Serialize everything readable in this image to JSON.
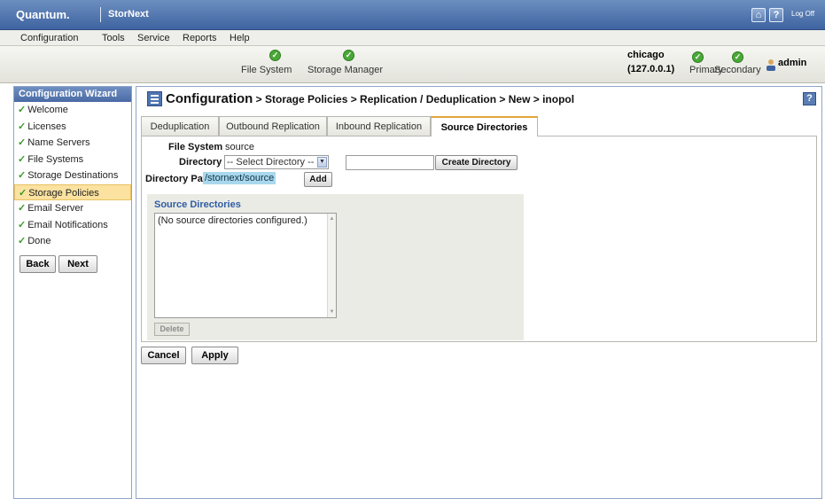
{
  "header": {
    "brand": "Quantum.",
    "product": "StorNext",
    "logoff": "Log Off"
  },
  "menu": [
    "Configuration",
    "Tools",
    "Service",
    "Reports",
    "Help"
  ],
  "status": {
    "file_system": "File System",
    "storage_manager": "Storage Manager",
    "host": "chicago",
    "ip": "(127.0.0.1)",
    "primary": "Primary",
    "secondary": "Secondary",
    "user": "admin",
    "ok_color": "#4aa838"
  },
  "wizard": {
    "title": "Configuration Wizard",
    "items": [
      {
        "label": "Welcome"
      },
      {
        "label": "Licenses"
      },
      {
        "label": "Name Servers"
      },
      {
        "label": "File Systems"
      },
      {
        "label": "Storage Destinations"
      },
      {
        "label": "Storage Policies",
        "active": true
      },
      {
        "label": "Email Server"
      },
      {
        "label": "Email Notifications"
      },
      {
        "label": "Done"
      }
    ],
    "back": "Back",
    "next": "Next"
  },
  "main": {
    "title": "Configuration",
    "breadcrumb": " > Storage Policies > Replication / Deduplication > New > inopol",
    "help": "?",
    "tabs": [
      "Deduplication",
      "Outbound Replication",
      "Inbound Replication",
      "Source Directories"
    ],
    "active_tab": "Source Directories",
    "file_system_label": "File System",
    "file_system_value": "source",
    "directory_label": "Directory",
    "directory_select": "-- Select Directory --",
    "create_directory": "Create Directory",
    "path_label": "Directory Path",
    "path_value": "/stornext/source",
    "add": "Add",
    "source_title": "Source Directories",
    "source_empty": "(No source directories configured.)",
    "delete": "Delete",
    "cancel": "Cancel",
    "apply": "Apply"
  }
}
